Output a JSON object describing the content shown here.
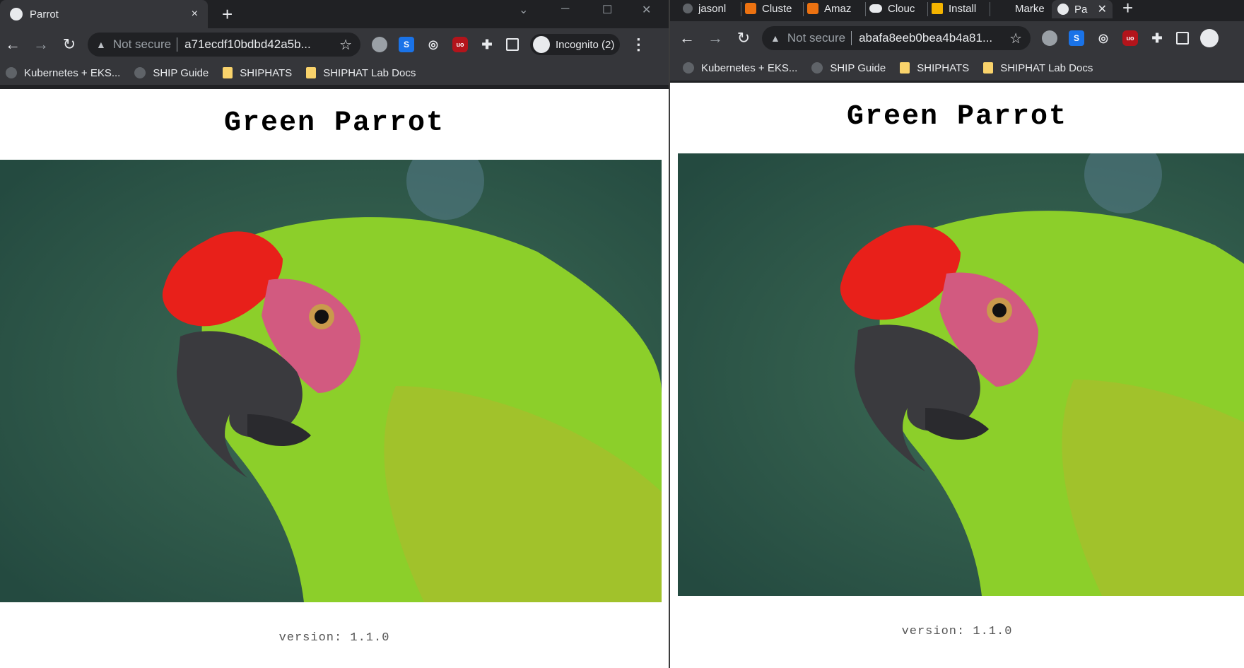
{
  "left_window": {
    "tab": {
      "title": "Parrot",
      "close": "×"
    },
    "new_tab": "+",
    "controls": {
      "minimize": "─",
      "maximize": "☐",
      "close": "✕"
    },
    "toolbar": {
      "back": "←",
      "forward": "→",
      "reload": "↻",
      "not_secure": "Not secure",
      "url": "a71ecdf10bdbd42a5b...",
      "star": "☆",
      "incognito_label": "Incognito (2)",
      "menu": "⋮"
    },
    "bookmarks": [
      "Kubernetes + EKS...",
      "SHIP Guide",
      "SHIPHATS",
      "SHIPHAT Lab Docs"
    ],
    "page": {
      "title": "Green Parrot",
      "version": "version: 1.1.0"
    }
  },
  "right_window": {
    "tabs": [
      "jasonl",
      "Cluste",
      "Amaz",
      "Clouc",
      "Install",
      "Marke",
      "Pa"
    ],
    "active_tab_close": "✕",
    "new_tab": "+",
    "toolbar": {
      "back": "←",
      "forward": "→",
      "reload": "↻",
      "not_secure": "Not secure",
      "url": "abafa8eeb0bea4b4a81...",
      "star": "☆"
    },
    "bookmarks": [
      "Kubernetes + EKS...",
      "SHIP Guide",
      "SHIPHATS",
      "SHIPHAT Lab Docs"
    ],
    "page": {
      "title": "Green Parrot",
      "version": "version: 1.1.0"
    }
  },
  "colors": {
    "chrome_dark": "#202124",
    "chrome_toolbar": "#35363a",
    "photo_bg": "#2f5a4c",
    "parrot_green": "#8ccf2a",
    "parrot_red": "#e8201a"
  },
  "icons": [
    "globe-icon",
    "shield-extension-icon",
    "s-extension-icon",
    "eye-extension-icon",
    "ublock-icon",
    "puzzle-icon",
    "sidepanel-icon",
    "incognito-icon",
    "folder-icon"
  ]
}
